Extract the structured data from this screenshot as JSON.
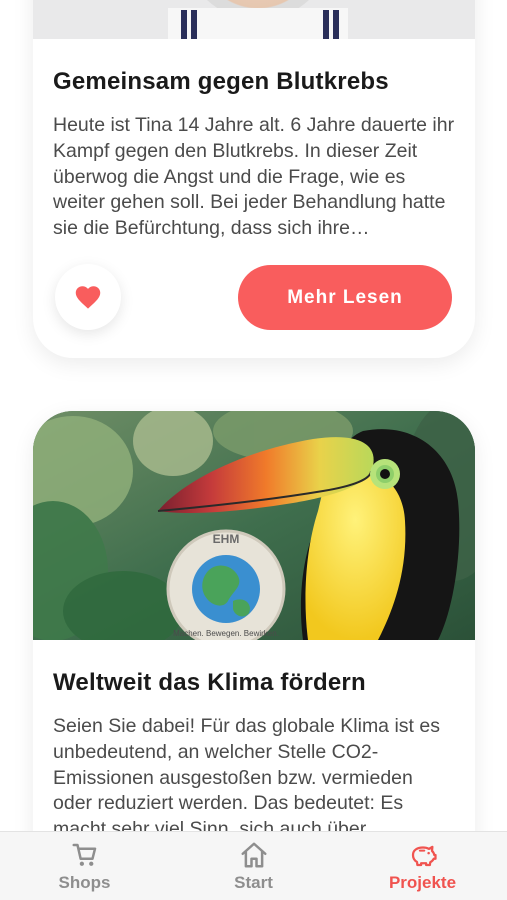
{
  "projects": [
    {
      "title": "Gemeinsam gegen Blutkrebs",
      "excerpt": "Heute ist Tina 14 Jahre alt. 6 Jahre dauerte ihr Kampf gegen den Blutkrebs. In dieser Zeit überwog die Angst und die Frage, wie es weiter gehen soll. Bei jeder Behandlung hatte sie die Befürchtung, dass sich ihre…",
      "favorite_icon": "heart-icon",
      "read_more_label": "Mehr Lesen"
    },
    {
      "title": "Weltweit das Klima fördern",
      "excerpt": "Seien Sie dabei! Für das globale Klima ist es unbedeutend, an welcher Stelle CO2-Emissionen ausgestoßen bzw. vermieden oder reduziert werden. Das bedeutet: Es macht sehr viel Sinn, sich auch über",
      "badge_text": "Machen. Bewegen. Bewirken."
    }
  ],
  "tabbar": {
    "tabs": [
      {
        "label": "Shops",
        "icon": "cart-icon",
        "active": false
      },
      {
        "label": "Start",
        "icon": "home-icon",
        "active": false
      },
      {
        "label": "Projekte",
        "icon": "piggy-bank-icon",
        "active": true
      }
    ]
  },
  "colors": {
    "accent": "#f95d5d",
    "tab_active": "#f0534f",
    "tab_inactive": "#8e8e8e"
  }
}
